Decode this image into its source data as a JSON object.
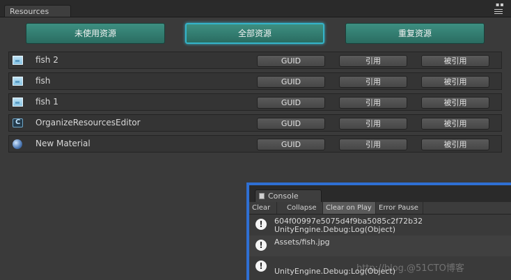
{
  "resources_window": {
    "tab_title": "Resources",
    "buttons": {
      "unused": "未使用资源",
      "all": "全部资源",
      "duplicate": "重复资源"
    },
    "rows": [
      {
        "name": "fish 2",
        "icon": "image-icon",
        "guid": "GUID",
        "ref": "引用",
        "referenced_by": "被引用"
      },
      {
        "name": "fish",
        "icon": "image-icon",
        "guid": "GUID",
        "ref": "引用",
        "referenced_by": "被引用"
      },
      {
        "name": "fish 1",
        "icon": "image-icon",
        "guid": "GUID",
        "ref": "引用",
        "referenced_by": "被引用"
      },
      {
        "name": "OrganizeResourcesEditor",
        "icon": "script-icon",
        "guid": "GUID",
        "ref": "引用",
        "referenced_by": "被引用"
      },
      {
        "name": "New Material",
        "icon": "material-icon",
        "guid": "GUID",
        "ref": "引用",
        "referenced_by": "被引用"
      }
    ]
  },
  "console": {
    "tab_title": "Console",
    "toolbar": {
      "clear": "Clear",
      "collapse": "Collapse",
      "clear_on_play": "Clear on Play",
      "error_pause": "Error Pause"
    },
    "logs": [
      {
        "line1": "604f00997e5075d4f9ba5085c2f72b32",
        "line2": "UnityEngine.Debug:Log(Object)"
      },
      {
        "line1": "Assets/fish.jpg",
        "line2": ""
      },
      {
        "line1": "",
        "line2": "UnityEngine.Debug:Log(Object)"
      }
    ]
  },
  "watermark": "http://blog.@51CTO博客",
  "colors": {
    "accent_button": "#2f7d70",
    "active_outline": "#34b4c9",
    "console_border": "#2f6fd3"
  }
}
